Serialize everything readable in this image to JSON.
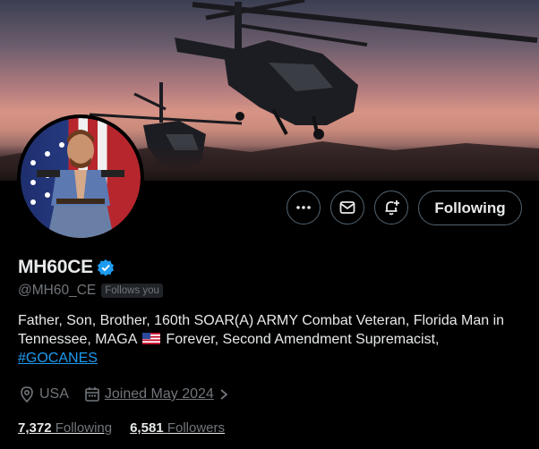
{
  "header": {
    "banner_alt": "helicopters",
    "avatar_alt": "avatar"
  },
  "actions": {
    "more_icon": "more-icon",
    "message_icon": "message-icon",
    "notify_icon": "bell-plus-icon",
    "follow_label": "Following"
  },
  "profile": {
    "display_name": "MH60CE",
    "verified": true,
    "handle": "@MH60_CE",
    "follows_you": "Follows you",
    "bio_text_1": "Father, Son, Brother, 160th SOAR(A) ARMY Combat Veteran, Florida Man in Tennessee, MAGA ",
    "bio_text_2": " Forever, Second Amendment Supremacist, ",
    "bio_hashtag": "#GOCANES",
    "location": "USA",
    "joined_prefix": "Joined",
    "joined": "May 2024",
    "following_count": "7,372",
    "following_label": "Following",
    "followers_count": "6,581",
    "followers_label": "Followers"
  },
  "colors": {
    "accent": "#1d9bf0",
    "secondary_text": "#71767b",
    "primary_text": "#e7e9ea",
    "background": "#000000",
    "border": "#536471"
  }
}
